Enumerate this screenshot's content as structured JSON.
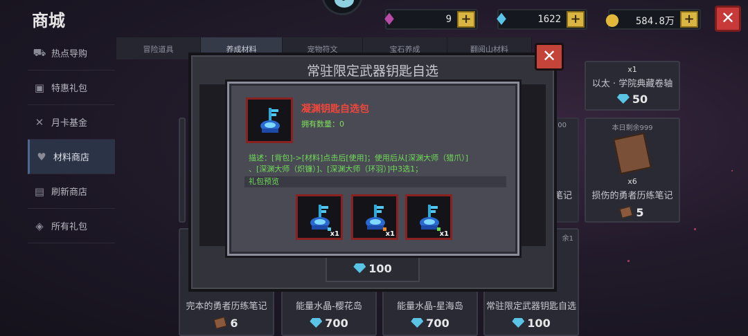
{
  "header": {
    "title": "商城",
    "currencies": [
      {
        "icon": "purple-gem-icon",
        "value": "9",
        "color": "#b84aa8"
      },
      {
        "icon": "blue-gem-icon",
        "value": "1622",
        "color": "#5ac4e6"
      },
      {
        "icon": "gold-coin-icon",
        "value": "584.8万",
        "color": "#e2b83a"
      }
    ]
  },
  "sidebar": {
    "items": [
      {
        "label": "热点导购",
        "icon": "cart-icon"
      },
      {
        "label": "特惠礼包",
        "icon": "gift-icon"
      },
      {
        "label": "月卡基金",
        "icon": "swords-icon"
      },
      {
        "label": "材料商店",
        "icon": "heart-gem-icon"
      },
      {
        "label": "刷新商店",
        "icon": "refresh-icon"
      },
      {
        "label": "所有礼包",
        "icon": "diamond-icon"
      }
    ]
  },
  "tabs": [
    "冒险道具",
    "养成材料",
    "宠物符文",
    "宝石养成",
    "翻阅山材料"
  ],
  "grid": {
    "top_right_card": {
      "qty": "x1",
      "name": "以太 · 学院典藏卷轴",
      "price": "50"
    },
    "mid_right_card": {
      "limit": "本日剩余999",
      "qty": "x6",
      "name": "损伤的勇者历练笔记",
      "price": "5"
    },
    "partial_right_label": "笔记",
    "partial_counter": "00",
    "bottom_row": [
      {
        "name": "完本的勇者历练笔记",
        "price": "6",
        "currency": "book"
      },
      {
        "name": "能量水晶-樱花岛",
        "price": "700",
        "currency": "gem"
      },
      {
        "name": "能量水晶-星海岛",
        "price": "700",
        "currency": "gem"
      },
      {
        "name": "常驻限定武器钥匙自选",
        "price": "100",
        "currency": "gem"
      }
    ],
    "partial_bottom_right": "余1"
  },
  "outer_modal": {
    "title": "常驻限定武器钥匙自选",
    "price": "100"
  },
  "pack_dialog": {
    "name": "凝渊钥匙自选包",
    "owned": "拥有数量：0",
    "desc_line1": "描述：[背包]->[材料]点击后[使用]；使用后从[深渊大师（猎爪）]",
    "desc_line2": "、[深渊大师（炽镰）]、[深渊大师（环羽）]中3选1；",
    "preview_label": "礼包预览",
    "rewards": [
      {
        "qty": "x1",
        "spark_color": "#5ac4e6"
      },
      {
        "qty": "x1",
        "spark_color": "#f08a2a"
      },
      {
        "qty": "x1",
        "spark_color": "#6adc4a"
      }
    ]
  }
}
